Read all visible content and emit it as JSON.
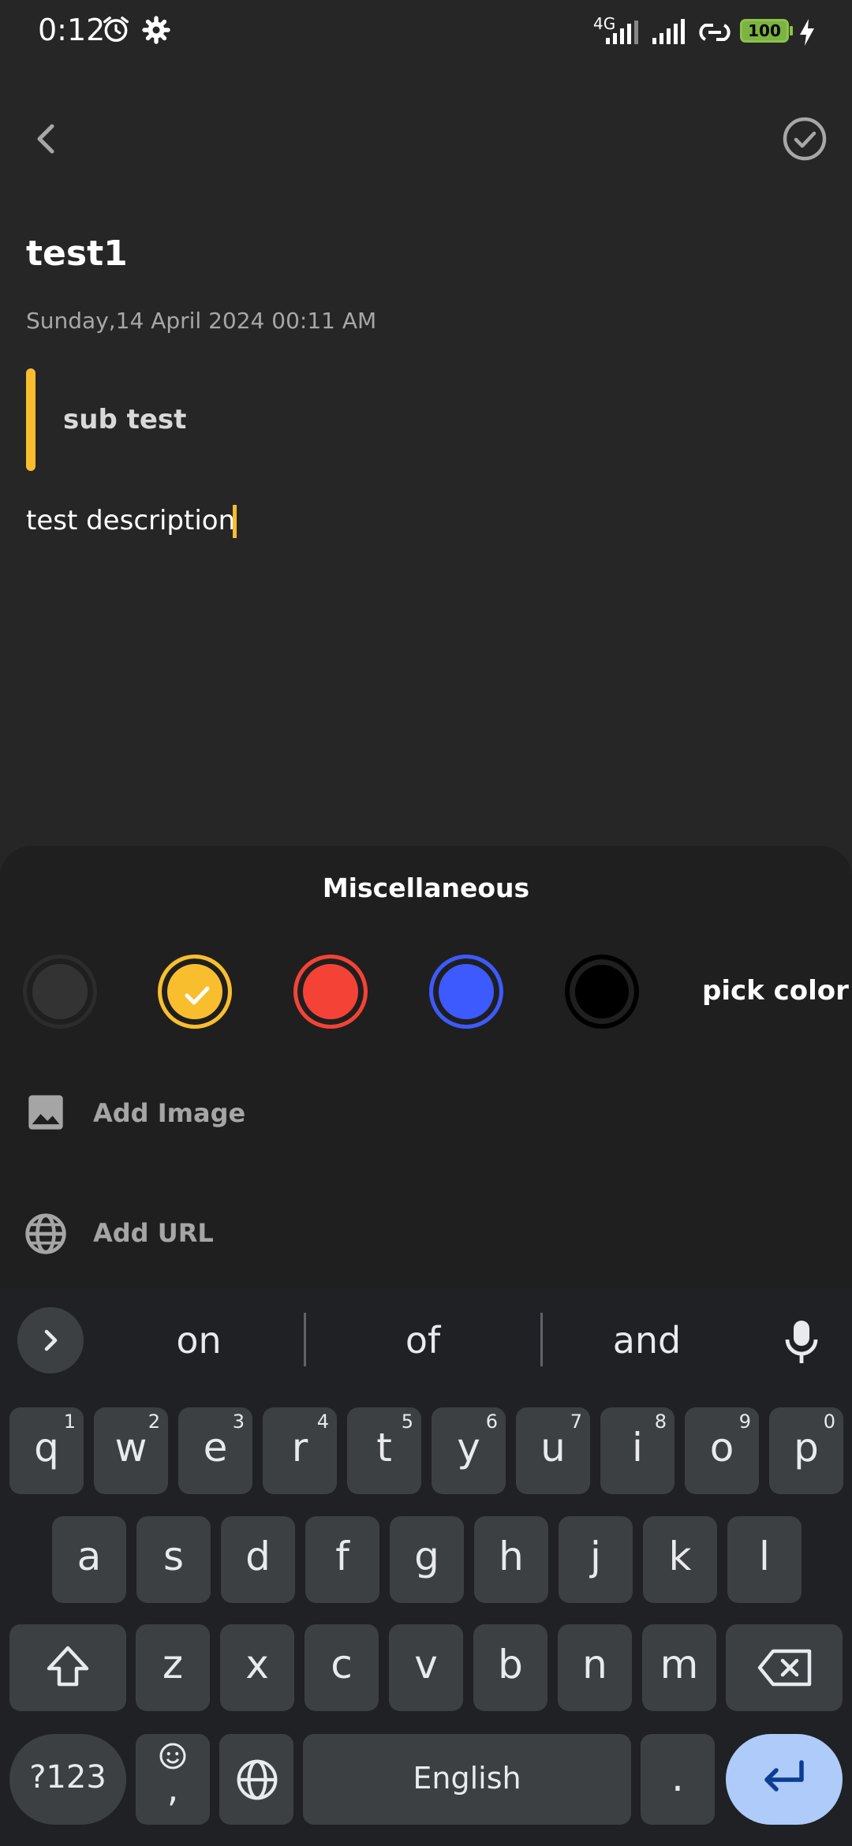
{
  "status_bar": {
    "time": "0:12",
    "network": "4G",
    "battery": "100"
  },
  "note": {
    "title": "test1",
    "date": "Sunday,14 April 2024 00:11 AM",
    "subtitle": "sub test",
    "description": "test description"
  },
  "sheet": {
    "title": "Miscellaneous",
    "colors": [
      "#333333",
      "#F9BE2E",
      "#F44336",
      "#3D5AFE",
      "#000000"
    ],
    "selected_color_index": 1,
    "pick_color_label": "pick color",
    "add_image_label": "Add Image",
    "add_url_label": "Add URL"
  },
  "keyboard": {
    "suggestions": [
      "on",
      "of",
      "and"
    ],
    "row1": [
      {
        "k": "q",
        "n": "1"
      },
      {
        "k": "w",
        "n": "2"
      },
      {
        "k": "e",
        "n": "3"
      },
      {
        "k": "r",
        "n": "4"
      },
      {
        "k": "t",
        "n": "5"
      },
      {
        "k": "y",
        "n": "6"
      },
      {
        "k": "u",
        "n": "7"
      },
      {
        "k": "i",
        "n": "8"
      },
      {
        "k": "o",
        "n": "9"
      },
      {
        "k": "p",
        "n": "0"
      }
    ],
    "row2": [
      "a",
      "s",
      "d",
      "f",
      "g",
      "h",
      "j",
      "k",
      "l"
    ],
    "row3": [
      "z",
      "x",
      "c",
      "v",
      "b",
      "n",
      "m"
    ],
    "symbols_label": "?123",
    "emoji_comma": ",",
    "space_label": "English",
    "period_label": "."
  }
}
